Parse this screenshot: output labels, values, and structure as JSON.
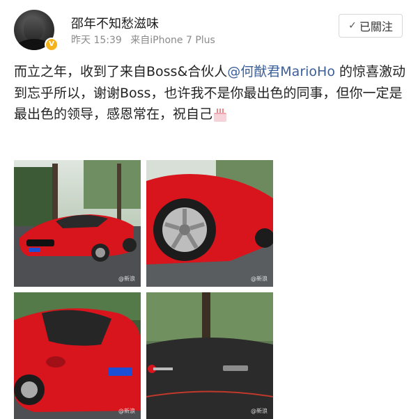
{
  "user": {
    "name": "邵年不知愁滋味",
    "time": "昨天 15:39",
    "source": "来自iPhone 7 Plus",
    "avatar_icon": "user-avatar",
    "verified_icon": "verified-badge-icon",
    "verified_mark": "V"
  },
  "follow_button": {
    "check_icon": "check-icon",
    "check_glyph": "✓",
    "label": "已關注"
  },
  "post": {
    "text_before_mention": "而立之年，收到了来自Boss&合伙人",
    "mention": "@何猷君MarioHo",
    "text_after_mention": " 的惊喜激动到忘乎所以，谢谢Boss，也许我不是你最出色的同事，但你一定是最出色的领导，感恩常在，祝自己",
    "emoji_icon": "birthday-cake-icon"
  },
  "photos": [
    {
      "name": "photo-red-ferrari-front",
      "watermark": "@新浪"
    },
    {
      "name": "photo-red-ferrari-wheel",
      "watermark": "@新浪"
    },
    {
      "name": "photo-red-ferrari-rear",
      "watermark": "@新浪"
    },
    {
      "name": "photo-ferrari-dashboard-key",
      "watermark": "@新浪"
    }
  ],
  "colors": {
    "link": "#3b5f99",
    "meta_gray": "#8a8a8a",
    "ferrari_red": "#d8141c",
    "verified_gold": "#f6b21b"
  }
}
